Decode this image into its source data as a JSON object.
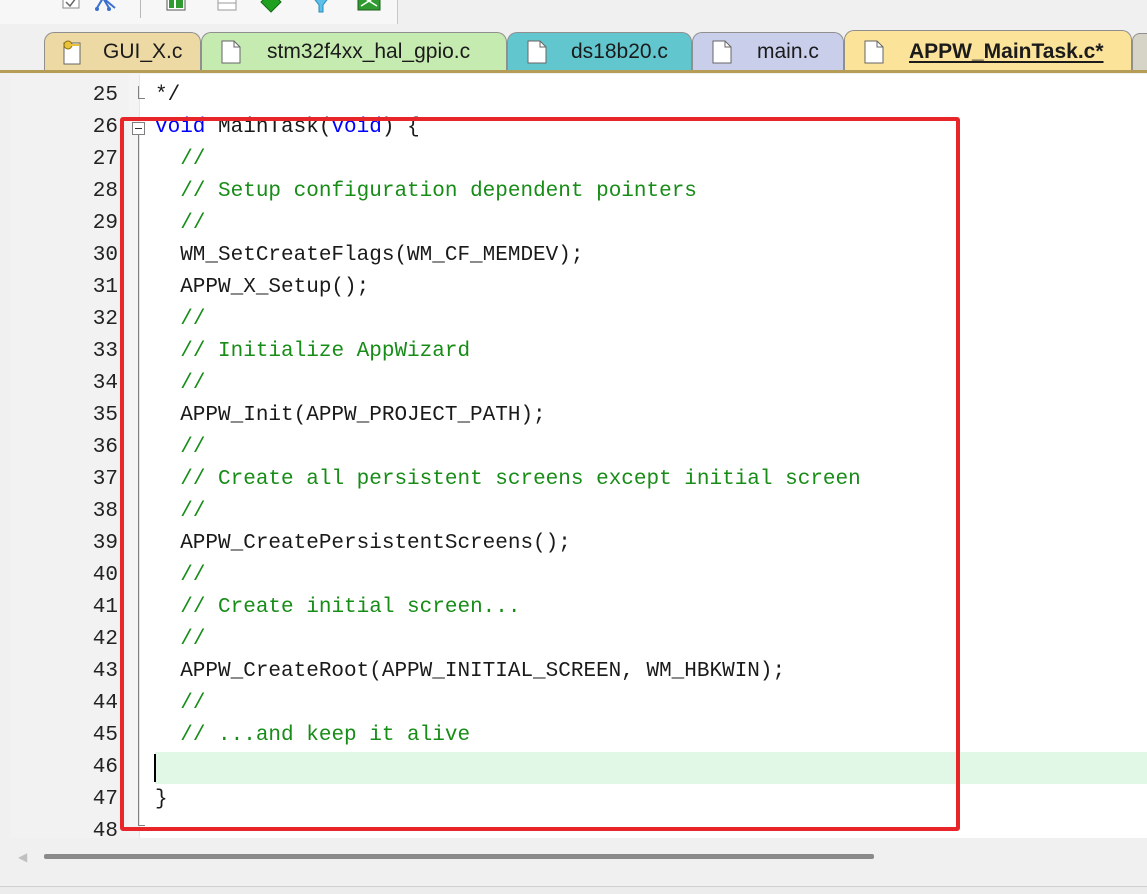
{
  "toolbar": {
    "buttons": [
      "checkbox-icon",
      "hierarchy-icon",
      "panels-icon",
      "window-icon",
      "diamond-icon",
      "filter-icon",
      "board-icon"
    ]
  },
  "tabs": [
    {
      "label": "GUI_X.c",
      "color": "#ecd9a3",
      "icon": "file-key-icon"
    },
    {
      "label": "stm32f4xx_hal_gpio.c",
      "color": "#c6ebb0",
      "icon": "file-icon"
    },
    {
      "label": "ds18b20.c",
      "color": "#62c6cf",
      "icon": "file-icon"
    },
    {
      "label": "main.c",
      "color": "#c9cfeb",
      "icon": "file-icon"
    },
    {
      "label": "APPW_MainTask.c*",
      "color": "#fbe39a",
      "icon": "file-icon",
      "active": true
    }
  ],
  "editor": {
    "lines": [
      {
        "n": "25",
        "text": "*/"
      },
      {
        "n": "26",
        "text": "void MainTask(void) {"
      },
      {
        "n": "27",
        "text": "  //"
      },
      {
        "n": "28",
        "text": "  // Setup configuration dependent pointers"
      },
      {
        "n": "29",
        "text": "  //"
      },
      {
        "n": "30",
        "text": "  WM_SetCreateFlags(WM_CF_MEMDEV);"
      },
      {
        "n": "31",
        "text": "  APPW_X_Setup();"
      },
      {
        "n": "32",
        "text": "  //"
      },
      {
        "n": "33",
        "text": "  // Initialize AppWizard"
      },
      {
        "n": "34",
        "text": "  //"
      },
      {
        "n": "35",
        "text": "  APPW_Init(APPW_PROJECT_PATH);"
      },
      {
        "n": "36",
        "text": "  //"
      },
      {
        "n": "37",
        "text": "  // Create all persistent screens except initial screen"
      },
      {
        "n": "38",
        "text": "  //"
      },
      {
        "n": "39",
        "text": "  APPW_CreatePersistentScreens();"
      },
      {
        "n": "40",
        "text": "  //"
      },
      {
        "n": "41",
        "text": "  // Create initial screen..."
      },
      {
        "n": "42",
        "text": "  //"
      },
      {
        "n": "43",
        "text": "  APPW_CreateRoot(APPW_INITIAL_SCREEN, WM_HBKWIN);"
      },
      {
        "n": "44",
        "text": "  //"
      },
      {
        "n": "45",
        "text": "  // ...and keep it alive"
      },
      {
        "n": "46",
        "text": ""
      },
      {
        "n": "47",
        "text": "}"
      },
      {
        "n": "48",
        "text": ""
      }
    ]
  },
  "colors": {
    "keyword": "#0000ff",
    "comment": "#178c17",
    "current_line": "#e2f8e6",
    "highlight_box": "#e8262a"
  }
}
